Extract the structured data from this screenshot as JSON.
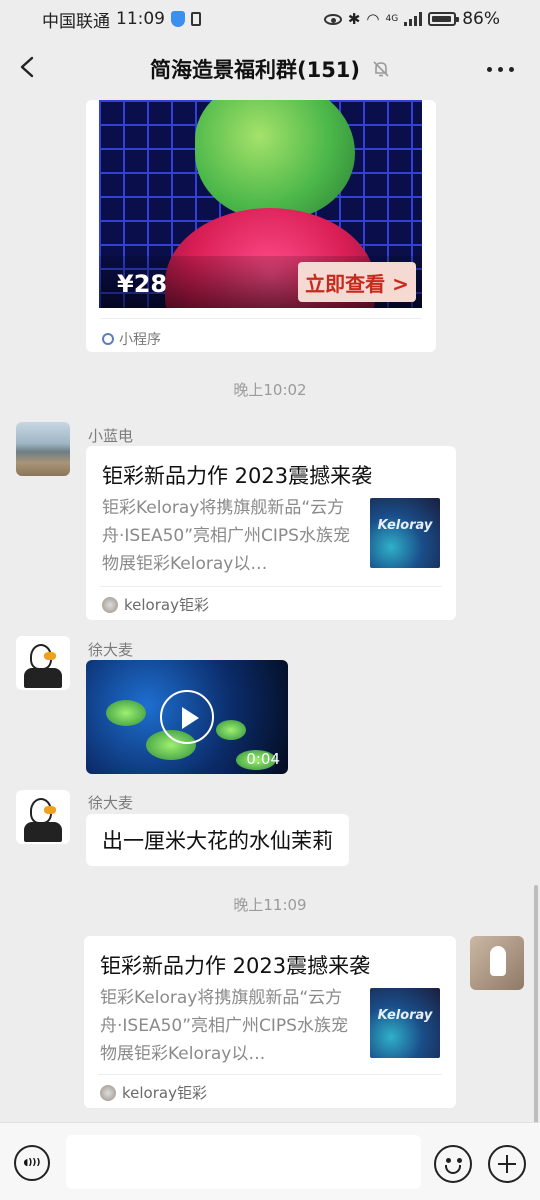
{
  "status": {
    "carrier": "中国联通",
    "time": "11:09",
    "network_badge": "4G",
    "battery": "86%"
  },
  "header": {
    "title": "简海造景福利群(151)"
  },
  "messages": {
    "mini_program": {
      "price": "¥28",
      "cta": "立即查看 >",
      "source": "小程序"
    },
    "time1": "晚上10:02",
    "msg1": {
      "sender": "小蓝电",
      "title": "钜彩新品力作 2023震撼来袭",
      "desc": "钜彩Keloray将携旗舰新品“云方舟·ISEA50”亮相广州CIPS水族宠物展钜彩Keloray以…",
      "thumb_text": "Keloray",
      "source": "keloray钜彩"
    },
    "msg2": {
      "sender": "徐大麦",
      "duration": "0:04"
    },
    "msg3": {
      "sender": "徐大麦",
      "text": "出一厘米大花的水仙茉莉"
    },
    "time2": "晚上11:09",
    "msg4": {
      "title": "钜彩新品力作 2023震撼来袭",
      "desc": "钜彩Keloray将携旗舰新品“云方舟·ISEA50”亮相广州CIPS水族宠物展钜彩Keloray以…",
      "thumb_text": "Keloray",
      "source": "keloray钜彩"
    }
  },
  "input": {
    "value": "",
    "voice_glyph": "◖)))"
  }
}
